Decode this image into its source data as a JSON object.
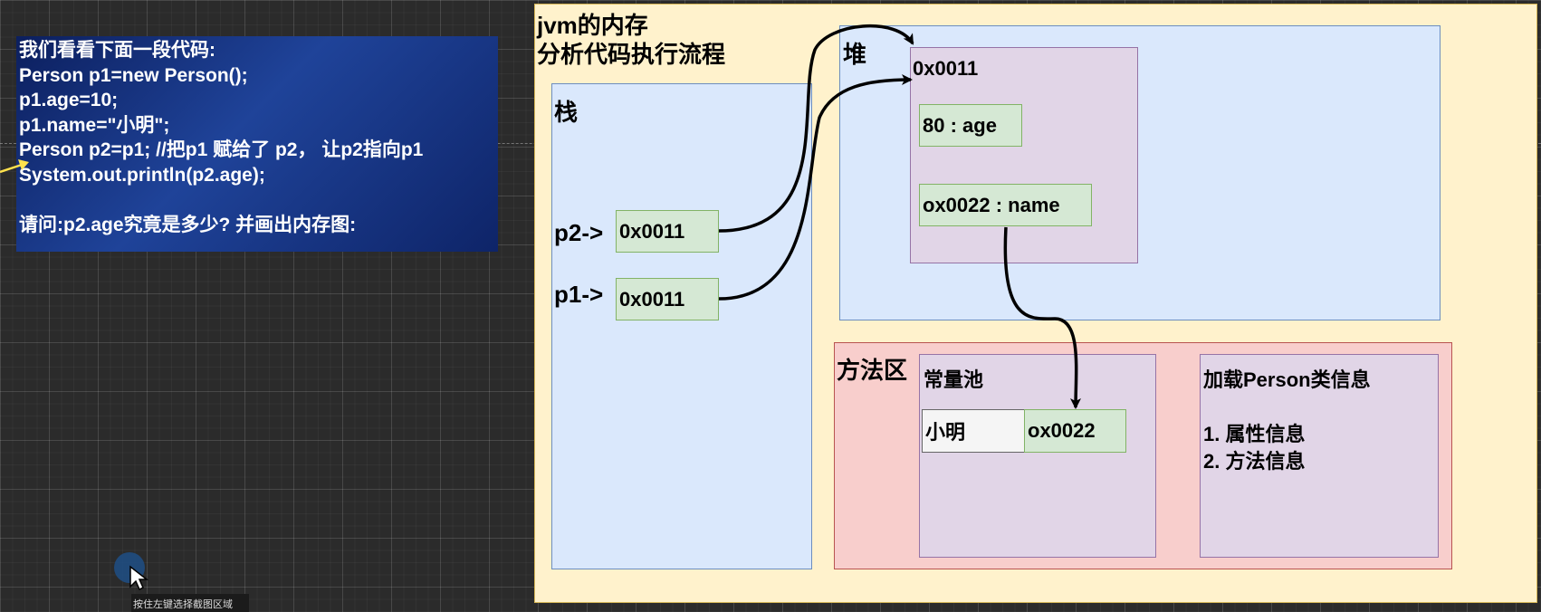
{
  "code_panel": {
    "lines": [
      "我们看看下面一段代码:",
      "Person p1=new Person();",
      "p1.age=10;",
      "p1.name=\"小明\";",
      "Person p2=p1; //把p1 赋给了 p2， 让p2指向p1",
      "System.out.println(p2.age);",
      "",
      "请问:p2.age究竟是多少? 并画出内存图:"
    ]
  },
  "diagram": {
    "title_line1": "jvm的内存",
    "title_line2": "分析代码执行流程",
    "stack": {
      "label": "栈",
      "p2_label": "p2->",
      "p2_value": "0x0011",
      "p1_label": "p1->",
      "p1_value": "0x0011"
    },
    "heap": {
      "label": "堆",
      "object_address": "0x0011",
      "field_age": "80 : age",
      "field_name": "ox0022 : name"
    },
    "method_area": {
      "label": "方法区",
      "constant_pool": {
        "label": "常量池",
        "string_value": "小明",
        "string_address": "ox0022"
      },
      "class_info": {
        "title": "加载Person类信息",
        "item1": "1. 属性信息",
        "item2": "2. 方法信息"
      }
    }
  },
  "tooltip": "按住左键选择截图区域",
  "colors": {
    "canvas": "#fff2cc",
    "blue_box": "#dae8fc",
    "purple_box": "#e1d5e7",
    "green_box": "#d5e8d4",
    "red_box": "#f8cecc",
    "code_panel": "#1f4399"
  }
}
